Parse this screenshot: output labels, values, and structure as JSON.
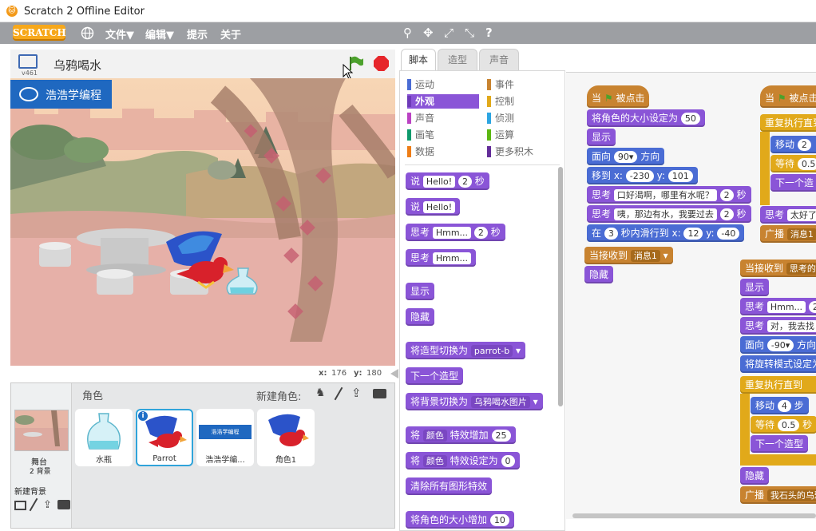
{
  "window": {
    "title": "Scratch 2 Offline Editor"
  },
  "menubar": {
    "logo": "SCRATCH",
    "file": "文件▼",
    "edit": "编辑▼",
    "tips": "提示",
    "about": "关于"
  },
  "stage": {
    "version": "v461",
    "title": "乌鸦喝水",
    "banner": "浩浩学编程",
    "x_label": "x:",
    "x": "176",
    "y_label": "y:",
    "y": "180"
  },
  "sprites": {
    "header": "角色",
    "new_sprite": "新建角色:",
    "stage_label": "舞台",
    "stage_backdrops": "2 背景",
    "new_backdrop": "新建背景",
    "items": [
      {
        "name": "水瓶"
      },
      {
        "name": "Parrot"
      },
      {
        "name": "浩浩学编..."
      },
      {
        "name": "角色1"
      }
    ]
  },
  "tabs": {
    "scripts": "脚本",
    "costumes": "造型",
    "sounds": "声音"
  },
  "categories": [
    {
      "label": "运动",
      "color": "#4a6cd4"
    },
    {
      "label": "事件",
      "color": "#c88330"
    },
    {
      "label": "外观",
      "color": "#8a55d7"
    },
    {
      "label": "控制",
      "color": "#e1a91a"
    },
    {
      "label": "声音",
      "color": "#bb42c3"
    },
    {
      "label": "侦测",
      "color": "#2ca5e2"
    },
    {
      "label": "画笔",
      "color": "#0e9a6c"
    },
    {
      "label": "运算",
      "color": "#5cb712"
    },
    {
      "label": "数据",
      "color": "#ee7d16"
    },
    {
      "label": "更多积木",
      "color": "#632d99"
    }
  ],
  "palette": {
    "say_secs": {
      "a": "说",
      "v": "Hello!",
      "n": "2",
      "b": "秒"
    },
    "say": {
      "a": "说",
      "v": "Hello!"
    },
    "think_secs": {
      "a": "思考",
      "v": "Hmm...",
      "n": "2",
      "b": "秒"
    },
    "think": {
      "a": "思考",
      "v": "Hmm..."
    },
    "show": "显示",
    "hide": "隐藏",
    "switch_costume": {
      "a": "将造型切换为",
      "v": "parrot-b"
    },
    "next_costume": "下一个造型",
    "switch_backdrop": {
      "a": "将背景切换为",
      "v": "乌鸦喝水图片"
    },
    "change_effect": {
      "a": "将",
      "v": "颜色",
      "b": "特效增加",
      "n": "25"
    },
    "set_effect": {
      "a": "将",
      "v": "颜色",
      "b": "特效设定为",
      "n": "0"
    },
    "clear_effects": "清除所有图形特效",
    "change_size": {
      "a": "将角色的大小增加",
      "n": "10"
    }
  },
  "script1": {
    "hat": {
      "a": "当",
      "b": "被点击"
    },
    "set_size": {
      "a": "将角色的大小设定为",
      "n": "50"
    },
    "show": "显示",
    "point": {
      "a": "面向",
      "n": "90▾",
      "b": "方向"
    },
    "goto": {
      "a": "移到 x:",
      "x": "-230",
      "b": "y:",
      "y": "101"
    },
    "think1": {
      "a": "思考",
      "v": "口好渴啊，哪里有水呢？",
      "n": "2",
      "b": "秒"
    },
    "think2": {
      "a": "思考",
      "v": "咦，那边有水，我要过去",
      "n": "2",
      "b": "秒"
    },
    "glide": {
      "a": "在",
      "n": "3",
      "b": "秒内滑行到 x:",
      "x": "12",
      "c": "y:",
      "y": "-40"
    }
  },
  "script2": {
    "hat": {
      "a": "当接收到",
      "v": "消息1"
    },
    "hide": "隐藏"
  },
  "script3": {
    "hat": {
      "a": "当",
      "b": "被点击"
    },
    "forever": "重复执行直到",
    "move": {
      "a": "移动",
      "n": "2"
    },
    "wait": {
      "a": "等待",
      "n": "0.5"
    },
    "next": "下一个造",
    "think": {
      "a": "思考",
      "v": "太好了"
    },
    "broadcast": {
      "a": "广播",
      "v": "消息1"
    }
  },
  "script4": {
    "hat": {
      "a": "当接收到",
      "v": "思考的"
    },
    "show": "显示",
    "think1": {
      "a": "思考",
      "v": "Hmm...",
      "n": "2"
    },
    "think2": {
      "a": "思考",
      "v": "对，我去找"
    },
    "point": {
      "a": "面向",
      "n": "-90▾",
      "b": "方向"
    },
    "rotation": "将旋转模式设定为",
    "repeat": "重复执行直到",
    "move": {
      "a": "移动",
      "n": "4",
      "b": "步"
    },
    "wait": {
      "a": "等待",
      "n": "0.5",
      "b": "秒"
    },
    "next": "下一个造型",
    "hide": "隐藏",
    "broadcast": {
      "a": "广播",
      "v": "我石头的乌鸦"
    }
  }
}
